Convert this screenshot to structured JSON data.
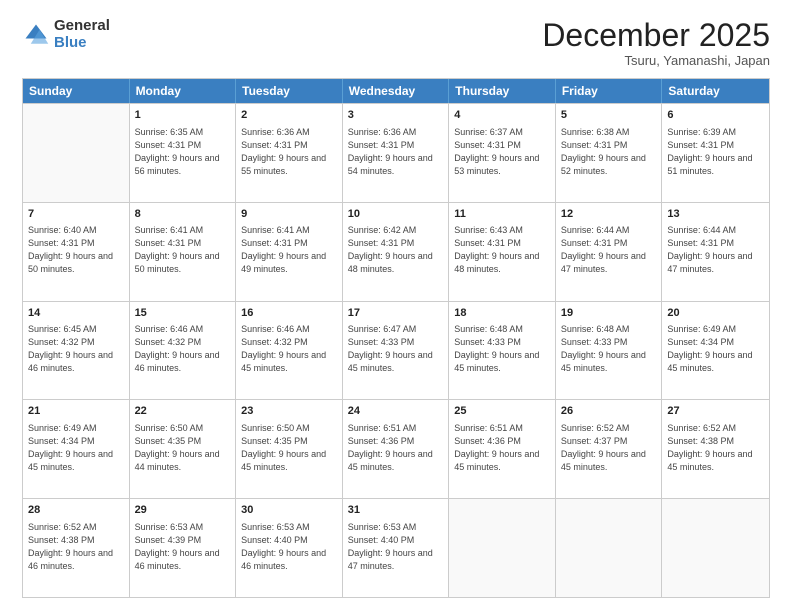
{
  "logo": {
    "general": "General",
    "blue": "Blue"
  },
  "header": {
    "month": "December 2025",
    "location": "Tsuru, Yamanashi, Japan"
  },
  "weekdays": [
    "Sunday",
    "Monday",
    "Tuesday",
    "Wednesday",
    "Thursday",
    "Friday",
    "Saturday"
  ],
  "weeks": [
    [
      {
        "day": "",
        "empty": true
      },
      {
        "day": "1",
        "sunrise": "Sunrise: 6:35 AM",
        "sunset": "Sunset: 4:31 PM",
        "daylight": "Daylight: 9 hours and 56 minutes."
      },
      {
        "day": "2",
        "sunrise": "Sunrise: 6:36 AM",
        "sunset": "Sunset: 4:31 PM",
        "daylight": "Daylight: 9 hours and 55 minutes."
      },
      {
        "day": "3",
        "sunrise": "Sunrise: 6:36 AM",
        "sunset": "Sunset: 4:31 PM",
        "daylight": "Daylight: 9 hours and 54 minutes."
      },
      {
        "day": "4",
        "sunrise": "Sunrise: 6:37 AM",
        "sunset": "Sunset: 4:31 PM",
        "daylight": "Daylight: 9 hours and 53 minutes."
      },
      {
        "day": "5",
        "sunrise": "Sunrise: 6:38 AM",
        "sunset": "Sunset: 4:31 PM",
        "daylight": "Daylight: 9 hours and 52 minutes."
      },
      {
        "day": "6",
        "sunrise": "Sunrise: 6:39 AM",
        "sunset": "Sunset: 4:31 PM",
        "daylight": "Daylight: 9 hours and 51 minutes."
      }
    ],
    [
      {
        "day": "7",
        "sunrise": "Sunrise: 6:40 AM",
        "sunset": "Sunset: 4:31 PM",
        "daylight": "Daylight: 9 hours and 50 minutes."
      },
      {
        "day": "8",
        "sunrise": "Sunrise: 6:41 AM",
        "sunset": "Sunset: 4:31 PM",
        "daylight": "Daylight: 9 hours and 50 minutes."
      },
      {
        "day": "9",
        "sunrise": "Sunrise: 6:41 AM",
        "sunset": "Sunset: 4:31 PM",
        "daylight": "Daylight: 9 hours and 49 minutes."
      },
      {
        "day": "10",
        "sunrise": "Sunrise: 6:42 AM",
        "sunset": "Sunset: 4:31 PM",
        "daylight": "Daylight: 9 hours and 48 minutes."
      },
      {
        "day": "11",
        "sunrise": "Sunrise: 6:43 AM",
        "sunset": "Sunset: 4:31 PM",
        "daylight": "Daylight: 9 hours and 48 minutes."
      },
      {
        "day": "12",
        "sunrise": "Sunrise: 6:44 AM",
        "sunset": "Sunset: 4:31 PM",
        "daylight": "Daylight: 9 hours and 47 minutes."
      },
      {
        "day": "13",
        "sunrise": "Sunrise: 6:44 AM",
        "sunset": "Sunset: 4:31 PM",
        "daylight": "Daylight: 9 hours and 47 minutes."
      }
    ],
    [
      {
        "day": "14",
        "sunrise": "Sunrise: 6:45 AM",
        "sunset": "Sunset: 4:32 PM",
        "daylight": "Daylight: 9 hours and 46 minutes."
      },
      {
        "day": "15",
        "sunrise": "Sunrise: 6:46 AM",
        "sunset": "Sunset: 4:32 PM",
        "daylight": "Daylight: 9 hours and 46 minutes."
      },
      {
        "day": "16",
        "sunrise": "Sunrise: 6:46 AM",
        "sunset": "Sunset: 4:32 PM",
        "daylight": "Daylight: 9 hours and 45 minutes."
      },
      {
        "day": "17",
        "sunrise": "Sunrise: 6:47 AM",
        "sunset": "Sunset: 4:33 PM",
        "daylight": "Daylight: 9 hours and 45 minutes."
      },
      {
        "day": "18",
        "sunrise": "Sunrise: 6:48 AM",
        "sunset": "Sunset: 4:33 PM",
        "daylight": "Daylight: 9 hours and 45 minutes."
      },
      {
        "day": "19",
        "sunrise": "Sunrise: 6:48 AM",
        "sunset": "Sunset: 4:33 PM",
        "daylight": "Daylight: 9 hours and 45 minutes."
      },
      {
        "day": "20",
        "sunrise": "Sunrise: 6:49 AM",
        "sunset": "Sunset: 4:34 PM",
        "daylight": "Daylight: 9 hours and 45 minutes."
      }
    ],
    [
      {
        "day": "21",
        "sunrise": "Sunrise: 6:49 AM",
        "sunset": "Sunset: 4:34 PM",
        "daylight": "Daylight: 9 hours and 45 minutes."
      },
      {
        "day": "22",
        "sunrise": "Sunrise: 6:50 AM",
        "sunset": "Sunset: 4:35 PM",
        "daylight": "Daylight: 9 hours and 44 minutes."
      },
      {
        "day": "23",
        "sunrise": "Sunrise: 6:50 AM",
        "sunset": "Sunset: 4:35 PM",
        "daylight": "Daylight: 9 hours and 45 minutes."
      },
      {
        "day": "24",
        "sunrise": "Sunrise: 6:51 AM",
        "sunset": "Sunset: 4:36 PM",
        "daylight": "Daylight: 9 hours and 45 minutes."
      },
      {
        "day": "25",
        "sunrise": "Sunrise: 6:51 AM",
        "sunset": "Sunset: 4:36 PM",
        "daylight": "Daylight: 9 hours and 45 minutes."
      },
      {
        "day": "26",
        "sunrise": "Sunrise: 6:52 AM",
        "sunset": "Sunset: 4:37 PM",
        "daylight": "Daylight: 9 hours and 45 minutes."
      },
      {
        "day": "27",
        "sunrise": "Sunrise: 6:52 AM",
        "sunset": "Sunset: 4:38 PM",
        "daylight": "Daylight: 9 hours and 45 minutes."
      }
    ],
    [
      {
        "day": "28",
        "sunrise": "Sunrise: 6:52 AM",
        "sunset": "Sunset: 4:38 PM",
        "daylight": "Daylight: 9 hours and 46 minutes."
      },
      {
        "day": "29",
        "sunrise": "Sunrise: 6:53 AM",
        "sunset": "Sunset: 4:39 PM",
        "daylight": "Daylight: 9 hours and 46 minutes."
      },
      {
        "day": "30",
        "sunrise": "Sunrise: 6:53 AM",
        "sunset": "Sunset: 4:40 PM",
        "daylight": "Daylight: 9 hours and 46 minutes."
      },
      {
        "day": "31",
        "sunrise": "Sunrise: 6:53 AM",
        "sunset": "Sunset: 4:40 PM",
        "daylight": "Daylight: 9 hours and 47 minutes."
      },
      {
        "day": "",
        "empty": true
      },
      {
        "day": "",
        "empty": true
      },
      {
        "day": "",
        "empty": true
      }
    ]
  ]
}
